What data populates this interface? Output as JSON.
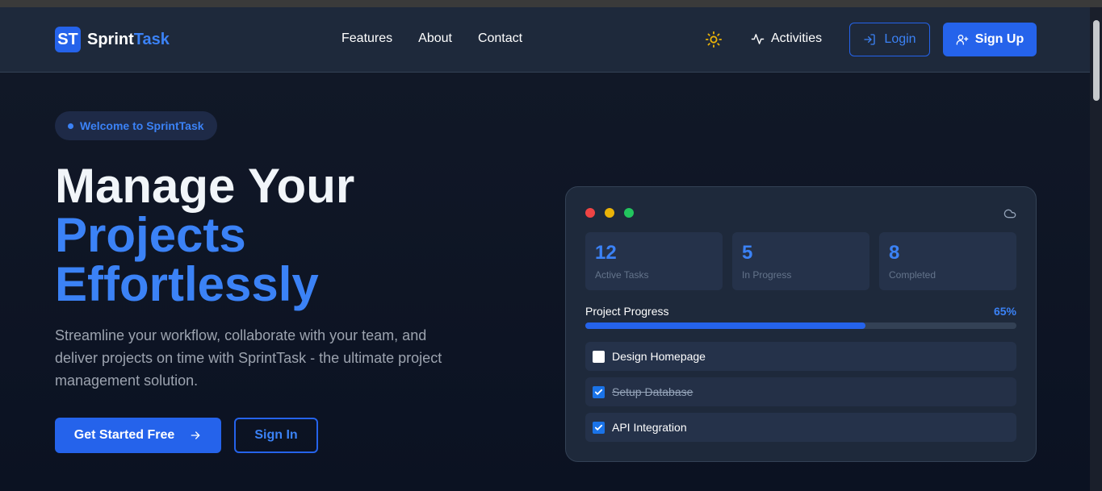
{
  "brand": {
    "badge": "ST",
    "name_part1": "Sprint",
    "name_part2": "Task",
    "accent_color": "#2563eb"
  },
  "nav": {
    "items": [
      "Features",
      "About",
      "Contact"
    ]
  },
  "header_actions": {
    "theme_icon": "sun-icon",
    "activities_label": "Activities",
    "login_label": "Login",
    "signup_label": "Sign Up"
  },
  "hero": {
    "badge_label": "Welcome to SprintTask",
    "headline_line1": "Manage Your",
    "headline_line2": "Projects",
    "headline_line3": "Effortlessly",
    "subtext": "Streamline your workflow, collaborate with your team, and deliver projects on time with SprintTask - the ultimate project management solution.",
    "cta_primary": "Get Started Free",
    "cta_secondary": "Sign In"
  },
  "preview_card": {
    "window_dot_colors": [
      "#ef4444",
      "#eab308",
      "#22c55e"
    ],
    "stats": [
      {
        "value": "12",
        "label": "Active Tasks"
      },
      {
        "value": "5",
        "label": "In Progress"
      },
      {
        "value": "8",
        "label": "Completed"
      }
    ],
    "progress": {
      "label": "Project Progress",
      "percent_text": "65%",
      "value": 0.65
    },
    "tasks": [
      {
        "label": "Design Homepage",
        "checked": false,
        "strikethrough": false
      },
      {
        "label": "Setup Database",
        "checked": true,
        "strikethrough": true
      },
      {
        "label": "API Integration",
        "checked": true,
        "strikethrough": false
      }
    ]
  }
}
